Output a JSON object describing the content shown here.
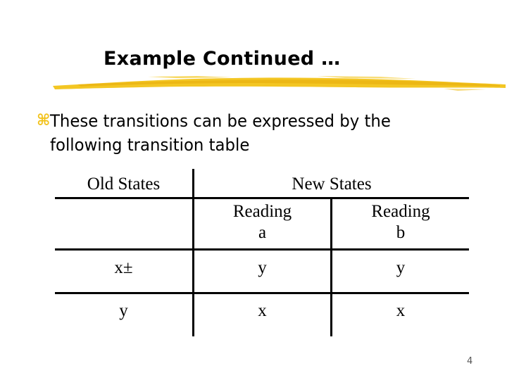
{
  "slide": {
    "title": "Example Continued …",
    "bullet": {
      "icon": "⌘",
      "line1": "These transitions can be expressed by the",
      "line2": "following transition table"
    },
    "table": {
      "old_states_header": "Old States",
      "new_states_header": "New States",
      "sub_headers": [
        {
          "line1": "Reading",
          "line2": "a"
        },
        {
          "line1": "Reading",
          "line2": "b"
        }
      ],
      "rows": [
        {
          "old": "x±",
          "on_a": "y",
          "on_b": "y"
        },
        {
          "old": "y",
          "on_a": "x",
          "on_b": "x"
        }
      ]
    },
    "page_number": "4",
    "colors": {
      "accent": "#f2c21a",
      "underline": "#f0c020"
    }
  }
}
